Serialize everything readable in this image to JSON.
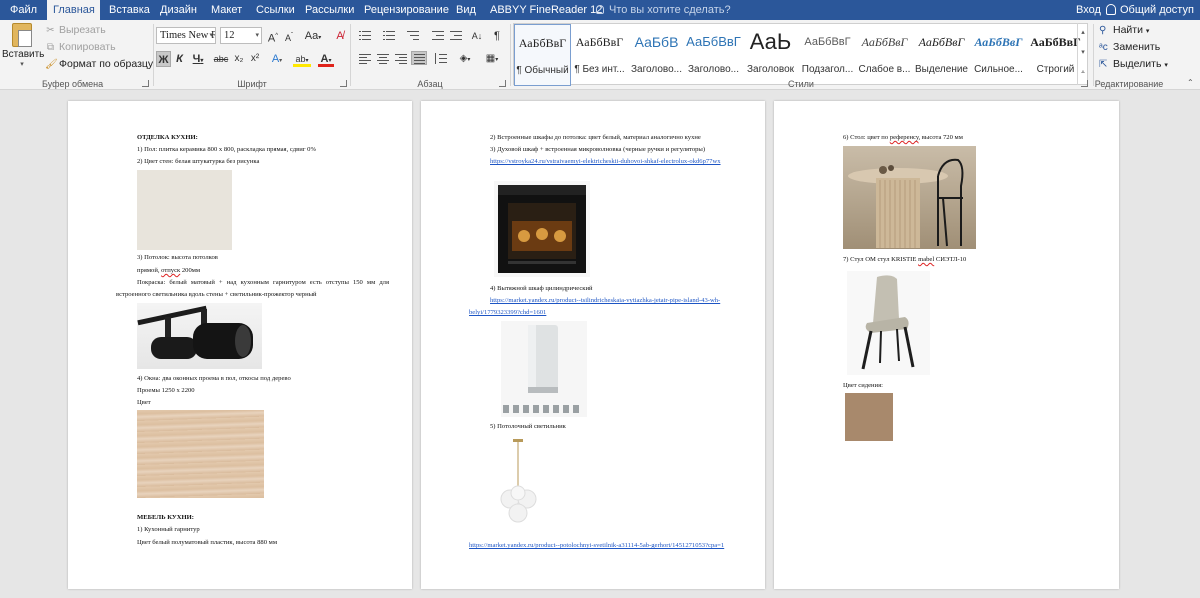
{
  "menu": {
    "tabs": [
      "Файл",
      "Главная",
      "Вставка",
      "Дизайн",
      "Макет",
      "Ссылки",
      "Рассылки",
      "Рецензирование",
      "Вид",
      "ABBYY FineReader 12"
    ],
    "active_tab": "Главная",
    "tell_me": "Что вы хотите сделать?",
    "sign_in": "Вход",
    "share": "Общий доступ",
    "accent_color": "#2b579a"
  },
  "ribbon": {
    "clipboard": {
      "label": "Буфер обмена",
      "paste": "Вставить",
      "cut": "Вырезать",
      "copy": "Копировать",
      "format_painter": "Формат по образцу"
    },
    "font": {
      "label": "Шрифт",
      "font_name": "Times New R",
      "font_size": "12",
      "grow": "A",
      "shrink": "A",
      "change_case": "Aa",
      "bold": "Ж",
      "italic": "К",
      "underline": "Ч",
      "strike": "abc",
      "subscript": "x₂",
      "superscript": "x²",
      "effects": "A",
      "highlight": "ab",
      "font_color": "A",
      "highlight_color": "#ffe800",
      "text_color": "#e0241b"
    },
    "paragraph": {
      "label": "Абзац"
    },
    "styles": {
      "label": "Стили",
      "items": [
        {
          "preview": "АаБбВвГ",
          "name": "¶ Обычный",
          "color": "#222222"
        },
        {
          "preview": "АаБбВвГ",
          "name": "¶ Без инт...",
          "color": "#222222"
        },
        {
          "preview": "АаБбВ",
          "name": "Заголово...",
          "color": "#2e74b5"
        },
        {
          "preview": "АаБбВвГ",
          "name": "Заголово...",
          "color": "#2e74b5"
        },
        {
          "preview": "АаЬ",
          "name": "Заголовок",
          "color": "#222222"
        },
        {
          "preview": "АаБбВвГ",
          "name": "Подзагол...",
          "color": "#5a5a5a"
        },
        {
          "preview": "АаБбВвГ",
          "name": "Слабое в...",
          "color": "#404040"
        },
        {
          "preview": "АаБбВвГ",
          "name": "Выделение",
          "color": "#222222"
        },
        {
          "preview": "АаБбВвГ",
          "name": "Сильное...",
          "color": "#2e74b5"
        },
        {
          "preview": "АаБбВвГ",
          "name": "Строгий",
          "color": "#222222"
        }
      ]
    },
    "editing": {
      "label": "Редактирование",
      "find": "Найти",
      "replace": "Заменить",
      "select": "Выделить"
    }
  },
  "page1": {
    "l1": "ОТДЕЛКА КУХНИ:",
    "l2": "1) Пол: плитка керамика 800 х 800, раскладка прямая, сдвиг 0%",
    "l3": "2) Цвет стен: белая штукатурка без рисунка",
    "l4": "3) Потолок: высота потолков",
    "l5a": "прямой, ",
    "l5b": "отпуск",
    "l5c": " 200мм",
    "l6": "Покраска: белый матовый + над кухонным гарнитуром есть отступы 150 мм для",
    "l7": "встроенного светильника вдоль стены + светильник-прожектор черный",
    "l8": "4) Окна: два оконных проема в пол, откосы под дерево",
    "l9": "Проемы 1250 х 2200",
    "l10": "Цвет",
    "l11": "МЕБЕЛЬ КУХНИ:",
    "l12": "1) Кухонный гарнитур",
    "l13": "Цвет белый полуматовый пластик, высота 880 мм"
  },
  "page2": {
    "l1": "2) Встроенные шкафы до потолка: цвет белый, материал аналогично кухне",
    "l2": "3) Духовой шкаф + встроенная микроволновка (черные ручки и регуляторы)",
    "link1": "https://vstroyka24.ru/vstraivaemyi-elektricheskii-duhovoi-shkaf-electrolux-okd6p77wx",
    "l3": "4) Вытяжной шкаф цилиндрический",
    "link2a": "https://market.yandex.ru/product--tsilindricheskaia-vytiazhka-jetair-pipe-island-43-wh-",
    "link2b": "belyi/1779323399?chd=1601",
    "l4": "5) Потолочный светильник",
    "link3": "https://market.yandex.ru/product--potolochnyi-svetilnik-a31114-5ab-gerhort/1451271053?cpa=1"
  },
  "page3": {
    "l1a": "6) Стол: цвет по ",
    "l1b": "референсу",
    "l1c": ", высота 720 мм",
    "l2a": "7) Стул ОМ стул KRISTIE ",
    "l2b": "mabel",
    "l2c": " СИЭТЛ-10",
    "l3": "Цвет сидения:",
    "swatch_color": "#a8896c"
  }
}
